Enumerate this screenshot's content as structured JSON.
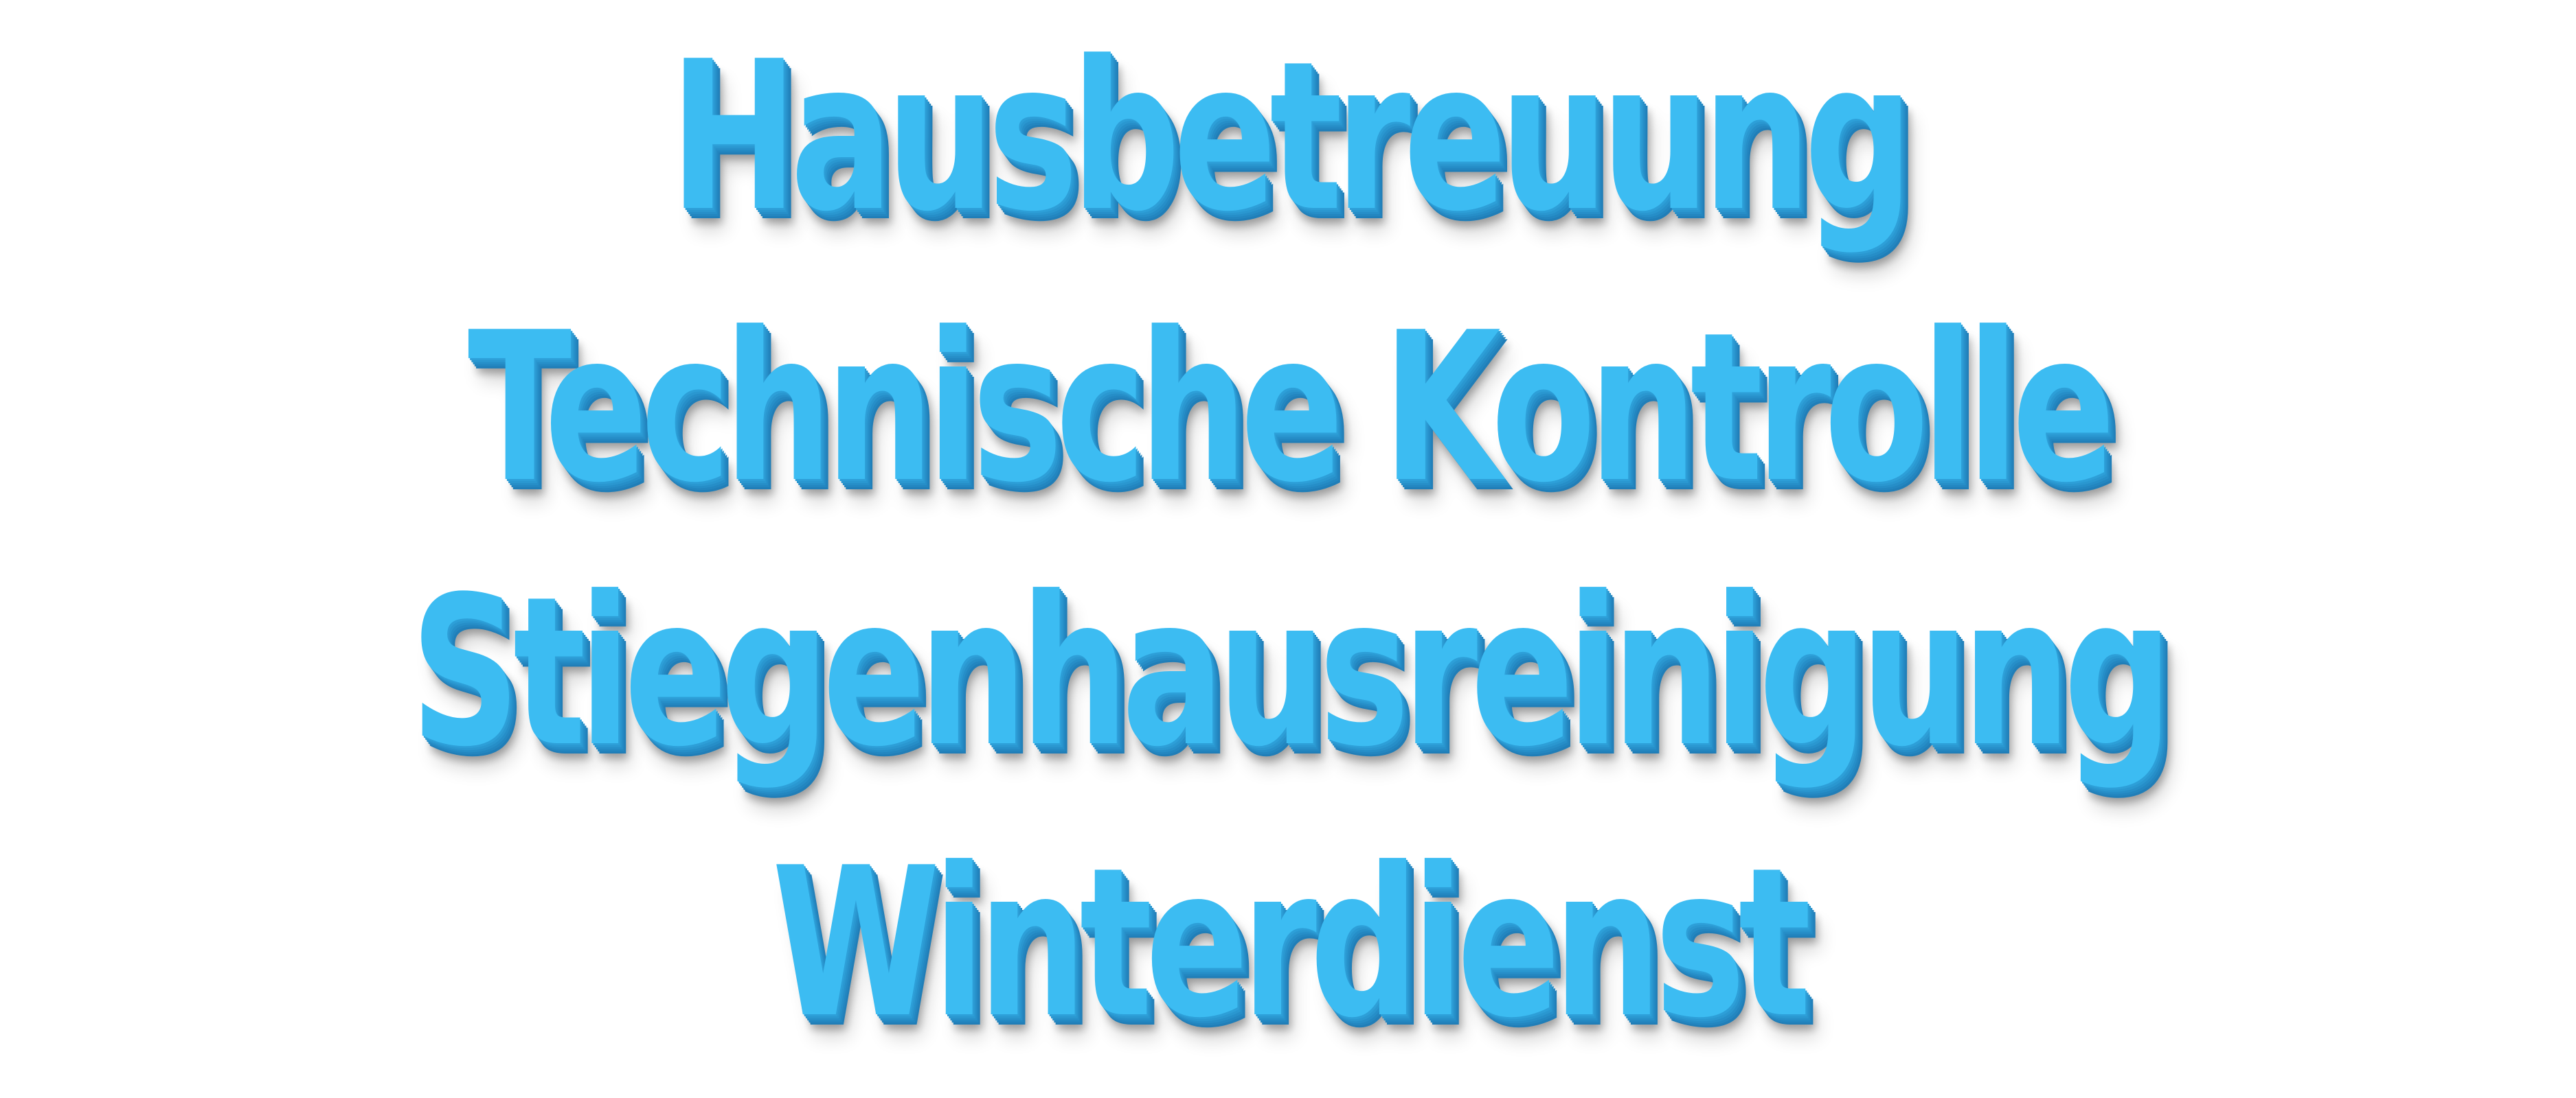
{
  "lines": [
    "Hausbetreuung",
    "Technische Kontrolle",
    "Stiegenhausreinigung",
    "Winterdienst"
  ],
  "colors": {
    "background": "#ffffff",
    "text_face": "#3cbcf2",
    "text_side": "#2386c0"
  }
}
